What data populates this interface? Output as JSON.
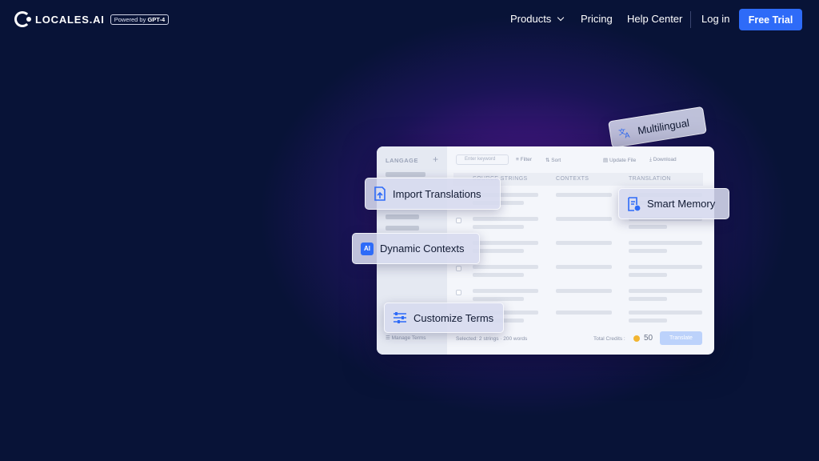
{
  "brand": {
    "name": "LOCALES.AI",
    "badge_prefix": "Powered by",
    "badge_model": "GPT-4"
  },
  "nav": {
    "products": "Products",
    "pricing": "Pricing",
    "help": "Help Center",
    "login": "Log in",
    "trial": "Free Trial"
  },
  "app": {
    "sidebar_title": "LANGAGE",
    "sidebar_manage_terms": "Manage Terms",
    "search_placeholder": "Enter keyword",
    "filter": "Filter",
    "sort": "Sort",
    "update_file": "Update File",
    "download": "Download",
    "columns": [
      "SOURCE STRINGS",
      "CONTEXTS",
      "TRANSLATION"
    ],
    "selected_text": "Selected: 2 strings · 200 words",
    "credits_label": "Total Credits :",
    "credits_value": "50",
    "translate_button": "Translate"
  },
  "features": {
    "multilingual": "Multilingual",
    "import": "Import Translations",
    "memory": "Smart Memory",
    "contexts": "Dynamic Contexts",
    "contexts_icon_text": "AI",
    "terms": "Customize Terms"
  },
  "colors": {
    "background": "#081337",
    "glow": "#5a1c96",
    "accent": "#2e6bf8"
  }
}
